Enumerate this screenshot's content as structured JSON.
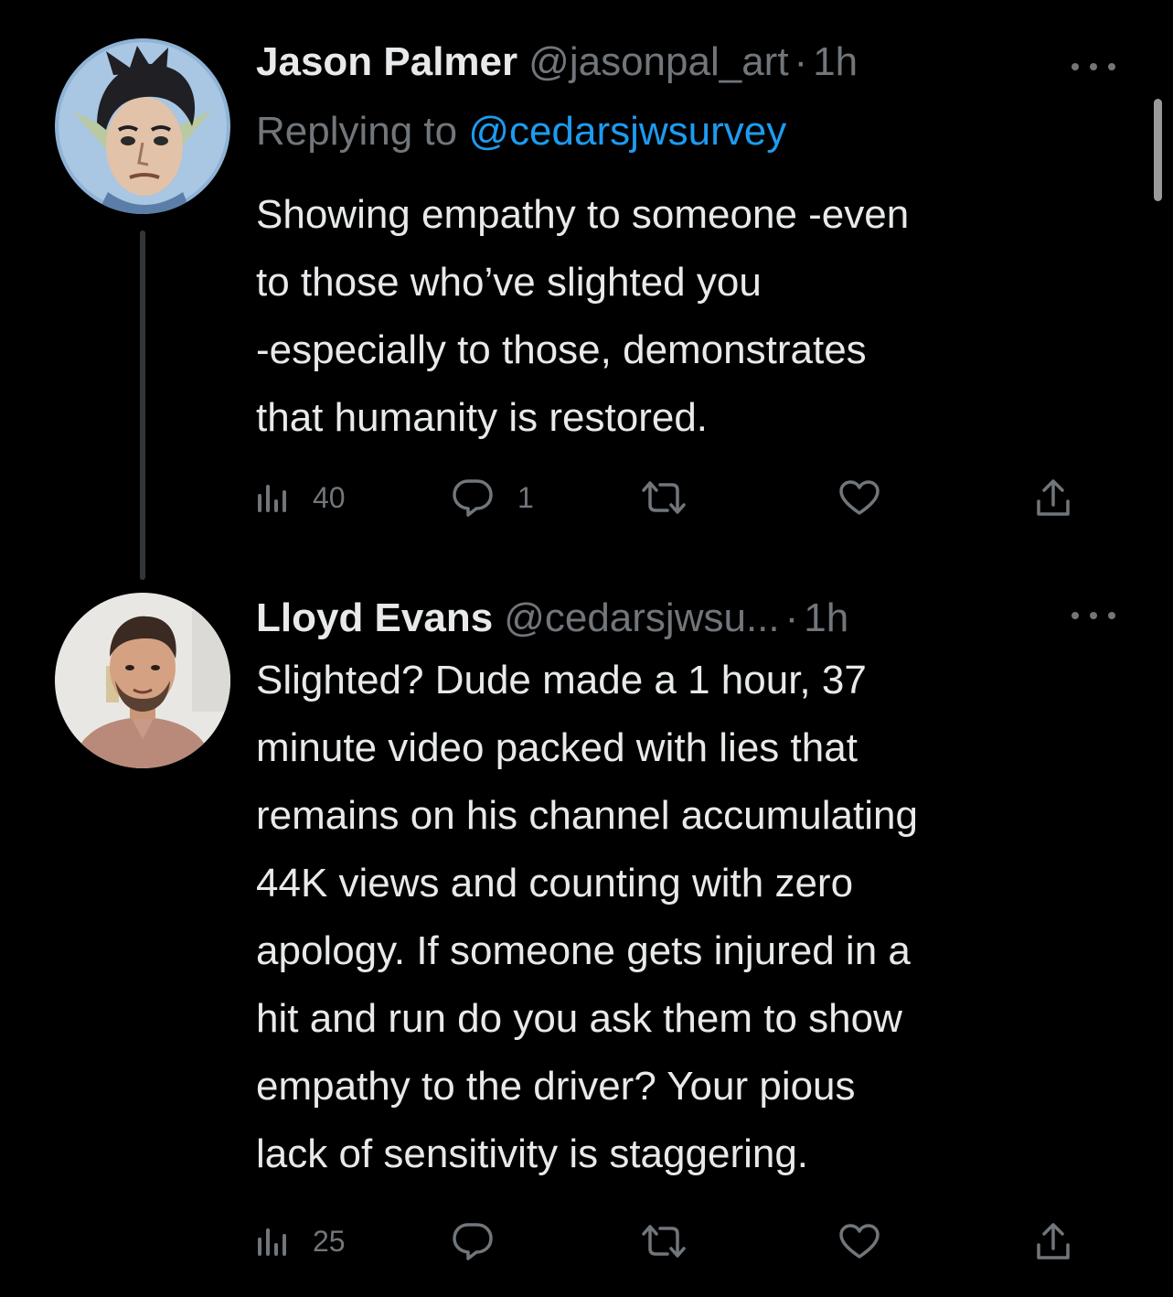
{
  "tweets": [
    {
      "display_name": "Jason Palmer",
      "handle": "@jasonpal_art",
      "dot": "·",
      "time": "1h",
      "avatar_icon": "avatar-illustration-elf-man",
      "replying_prefix": "Replying to",
      "replying_to": "@cedarsjwsurvey",
      "text_lines": [
        "Showing empathy to someone -even",
        "to those who’ve slighted you",
        "-especially to those, demonstrates",
        "that humanity is restored."
      ],
      "views": "40",
      "replies": "1",
      "retweets": "",
      "likes": ""
    },
    {
      "display_name": "Lloyd Evans",
      "handle": "@cedarsjwsu...",
      "dot": "·",
      "time": "1h",
      "avatar_icon": "avatar-photo-man",
      "text_lines": [
        "Slighted? Dude made a 1 hour, 37",
        "minute video packed with lies that",
        "remains on his channel accumulating",
        "44K views and counting with zero",
        "apology. If someone gets injured in a",
        "hit and run do you ask them to show",
        "empathy to the driver? Your pious",
        "lack of sensitivity is staggering."
      ],
      "views": "25",
      "replies": "",
      "retweets": "",
      "likes": ""
    }
  ],
  "colors": {
    "background": "#000000",
    "text_primary": "#e7e9ea",
    "text_secondary": "#71767b",
    "link": "#1d9bf0",
    "thread_line": "#333639"
  },
  "icons": {
    "views": "views-chart-icon",
    "reply": "reply-bubble-icon",
    "retweet": "retweet-icon",
    "like": "heart-icon",
    "share": "share-upload-icon",
    "more": "more-dots-icon"
  }
}
